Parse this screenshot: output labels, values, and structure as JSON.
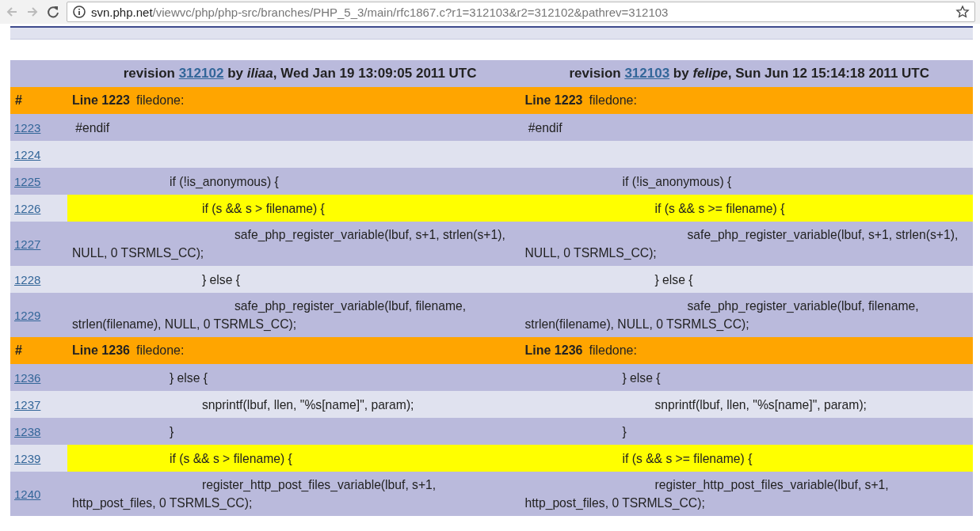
{
  "browser": {
    "url_host": "svn.php.net",
    "url_path": "/viewvc/php/php-src/branches/PHP_5_3/main/rfc1867.c?r1=312103&r2=312102&pathrev=312103"
  },
  "diff": {
    "revisions": [
      {
        "before": "revision",
        "link": "312102",
        "after": "by *iliaa*, Wed Jan 19 13:09:05 2011 UTC"
      },
      {
        "before": "revision",
        "link": "312103",
        "after": "by *felipe*, Sun Jun 12 15:14:18 2011 UTC"
      }
    ],
    "blocks": [
      {
        "number_heading": "#",
        "left": {
          "label": "Line 1223",
          "note": "filedone:"
        },
        "right": {
          "label": "Line 1223",
          "note": "filedone:"
        },
        "rows": [
          {
            "number": "1223",
            "changed": false,
            "left": " #endif",
            "right": " #endif"
          },
          {
            "number": "1224",
            "changed": false,
            "left": "",
            "right": ""
          },
          {
            "number": "1225",
            "changed": false,
            "left": "\t\t\tif (!is_anonymous) {",
            "right": "\t\t\tif (!is_anonymous) {"
          },
          {
            "number": "1226",
            "changed": true,
            "left": "\t\t\t\tif (s && s > filename) {",
            "right": "\t\t\t\tif (s && s >= filename) {"
          },
          {
            "number": "1227",
            "changed": false,
            "left": "\t\t\t\t\tsafe_php_register_variable(lbuf, s+1, strlen(s+1), NULL, 0 TSRMLS_CC);",
            "right": "\t\t\t\t\tsafe_php_register_variable(lbuf, s+1, strlen(s+1), NULL, 0 TSRMLS_CC);"
          },
          {
            "number": "1228",
            "changed": false,
            "left": "\t\t\t\t} else {",
            "right": "\t\t\t\t} else {"
          },
          {
            "number": "1229",
            "changed": false,
            "left": "\t\t\t\t\tsafe_php_register_variable(lbuf, filename, strlen(filename), NULL, 0 TSRMLS_CC);",
            "right": "\t\t\t\t\tsafe_php_register_variable(lbuf, filename, strlen(filename), NULL, 0 TSRMLS_CC);"
          }
        ]
      },
      {
        "number_heading": "#",
        "left": {
          "label": "Line 1236",
          "note": "filedone:"
        },
        "right": {
          "label": "Line 1236",
          "note": "filedone:"
        },
        "rows": [
          {
            "number": "1236",
            "changed": false,
            "left": "\t\t\t} else {",
            "right": "\t\t\t} else {"
          },
          {
            "number": "1237",
            "changed": false,
            "left": "\t\t\t\tsnprintf(lbuf, llen, \"%s[name]\", param);",
            "right": "\t\t\t\tsnprintf(lbuf, llen, \"%s[name]\", param);"
          },
          {
            "number": "1238",
            "changed": false,
            "left": "\t\t\t}",
            "right": "\t\t\t}"
          },
          {
            "number": "1239",
            "changed": true,
            "left": "\t\t\tif (s && s > filename) {",
            "right": "\t\t\tif (s && s >= filename) {"
          },
          {
            "number": "1240",
            "changed": false,
            "left": "\t\t\t\tregister_http_post_files_variable(lbuf, s+1, http_post_files, 0 TSRMLS_CC);",
            "right": "\t\t\t\tregister_http_post_files_variable(lbuf, s+1, http_post_files, 0 TSRMLS_CC);"
          }
        ]
      }
    ]
  }
}
